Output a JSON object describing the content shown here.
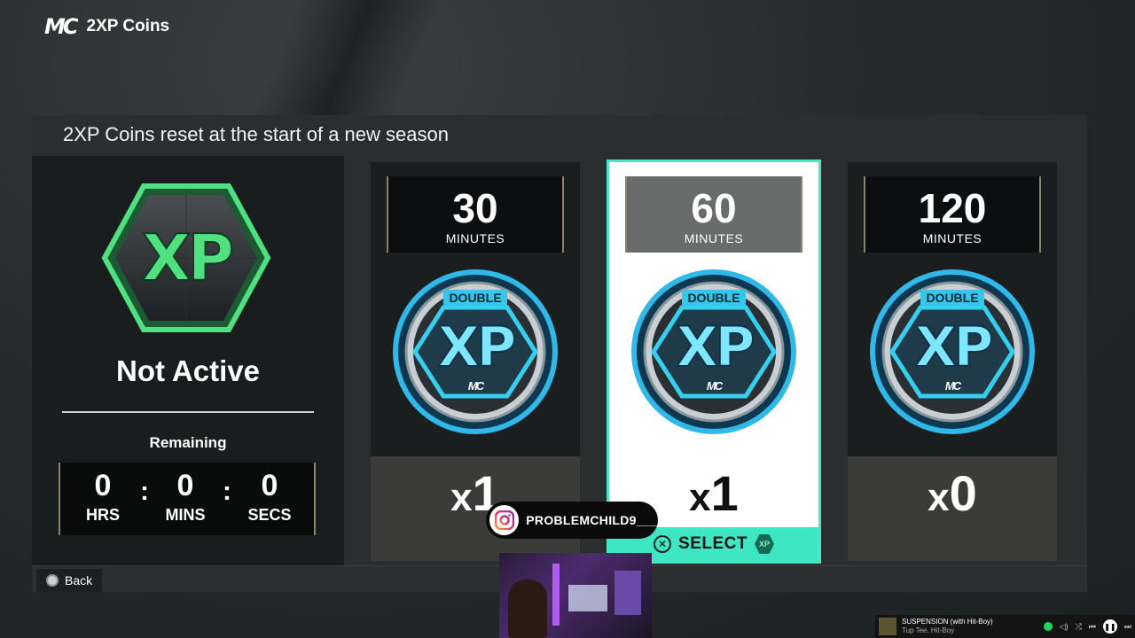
{
  "header": {
    "logo": "MC",
    "title": "2XP Coins"
  },
  "panel": {
    "title": "2XP Coins reset at the start of a new season"
  },
  "status": {
    "badge_text": "XP",
    "state": "Not Active",
    "remaining_label": "Remaining",
    "timer": {
      "hours": "0",
      "hours_label": "HRS",
      "mins": "0",
      "mins_label": "MINS",
      "secs": "0",
      "secs_label": "SECS",
      "separator": ":"
    }
  },
  "cards": [
    {
      "duration": "30",
      "unit": "MINUTES",
      "coin_top": "DOUBLE",
      "coin_main": "XP",
      "coin_logo": "MC",
      "qty_prefix": "x",
      "qty": "1",
      "selected": false
    },
    {
      "duration": "60",
      "unit": "MINUTES",
      "coin_top": "DOUBLE",
      "coin_main": "XP",
      "coin_logo": "MC",
      "qty_prefix": "x",
      "qty": "1",
      "selected": true
    },
    {
      "duration": "120",
      "unit": "MINUTES",
      "coin_top": "DOUBLE",
      "coin_main": "XP",
      "coin_logo": "MC",
      "qty_prefix": "x",
      "qty": "0",
      "selected": false
    }
  ],
  "select": {
    "button_glyph": "✕",
    "label": "SELECT",
    "chip": "XP"
  },
  "back": {
    "label": "Back"
  },
  "overlay": {
    "instagram_user": "PROBLEMCHILD9___"
  },
  "spotify": {
    "track": "SUSPENSION (with Hit-Boy)",
    "artist": "Tup Tee, Hit-Boy"
  },
  "colors": {
    "accent_teal": "#3fe6c3",
    "coin_blue": "#2fb8e8",
    "badge_green": "#46d67a",
    "frame_gold": "#8a8463"
  }
}
